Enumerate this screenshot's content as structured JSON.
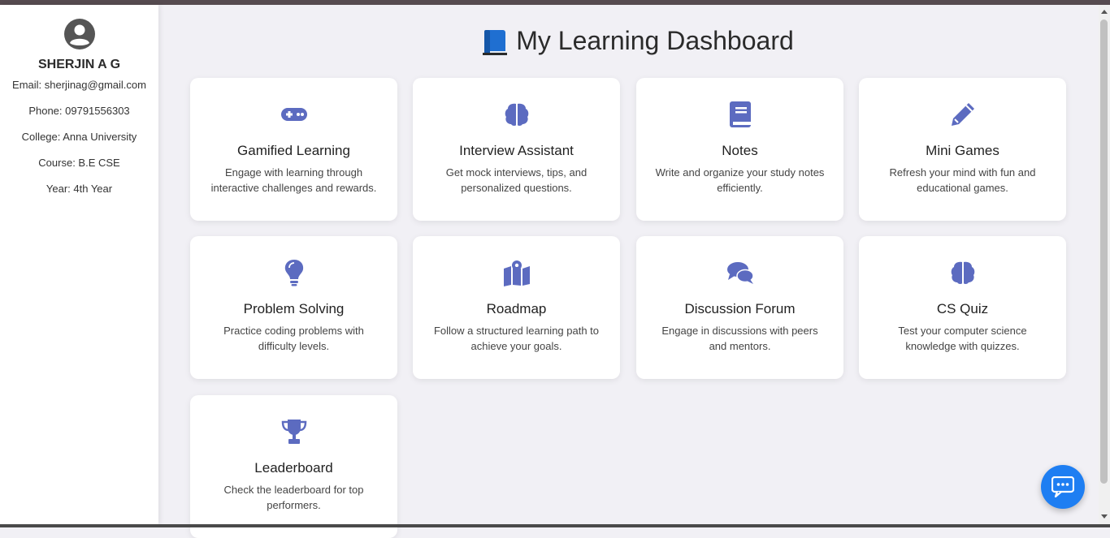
{
  "profile": {
    "name": "SHERJIN A G",
    "email": "Email: sherjinag@gmail.com",
    "phone": "Phone: 09791556303",
    "college": "College: Anna University",
    "course": "Course: B.E CSE",
    "year": "Year: 4th Year",
    "avatar_icon": "user-circle-icon"
  },
  "header": {
    "title": "My Learning Dashboard",
    "title_icon": "blue-book-icon"
  },
  "cards": [
    {
      "icon": "gamepad-icon",
      "title": "Gamified Learning",
      "desc": "Engage with learning through interactive challenges and rewards."
    },
    {
      "icon": "brain-icon",
      "title": "Interview Assistant",
      "desc": "Get mock interviews, tips, and personalized questions."
    },
    {
      "icon": "book-icon",
      "title": "Notes",
      "desc": "Write and organize your study notes efficiently."
    },
    {
      "icon": "pencil-icon",
      "title": "Mini Games",
      "desc": "Refresh your mind with fun and educational games."
    },
    {
      "icon": "lightbulb-icon",
      "title": "Problem Solving",
      "desc": "Practice coding problems with difficulty levels."
    },
    {
      "icon": "map-icon",
      "title": "Roadmap",
      "desc": "Follow a structured learning path to achieve your goals."
    },
    {
      "icon": "comments-icon",
      "title": "Discussion Forum",
      "desc": "Engage in discussions with peers and mentors."
    },
    {
      "icon": "brain-icon",
      "title": "CS Quiz",
      "desc": "Test your computer science knowledge with quizzes."
    },
    {
      "icon": "trophy-icon",
      "title": "Leaderboard",
      "desc": "Check the leaderboard for top performers."
    }
  ],
  "colors": {
    "accent": "#5c6bc0",
    "chat_button": "#1e7ef2",
    "background": "#f1f0f5"
  },
  "chat": {
    "icon": "chat-icon"
  }
}
